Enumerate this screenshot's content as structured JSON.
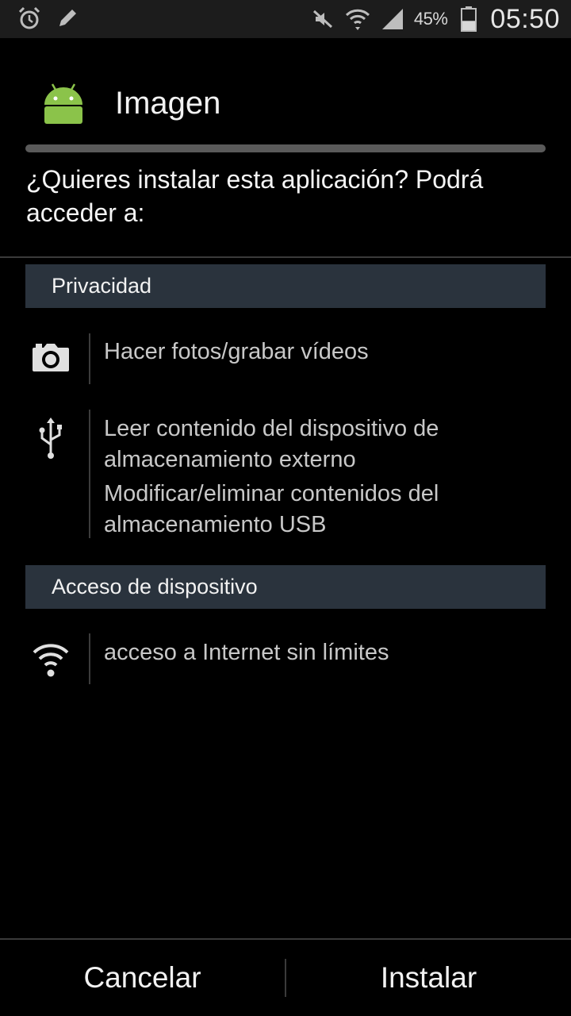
{
  "status_bar": {
    "left_icons": [
      "alarm-clock-icon",
      "pencil-icon"
    ],
    "right_icons": [
      "mute-icon",
      "wifi-icon",
      "signal-icon",
      "battery-icon"
    ],
    "battery_percent": "45%",
    "battery_level": 0.45,
    "time": "05:50"
  },
  "app": {
    "name": "Imagen",
    "icon": "android-robot-icon",
    "icon_color": "#8bc34a"
  },
  "prompt": "¿Quieres instalar esta aplicación? Podrá acceder a:",
  "sections": [
    {
      "title": "Privacidad",
      "permissions": [
        {
          "icon": "camera-icon",
          "lines": [
            "Hacer fotos/grabar vídeos"
          ]
        },
        {
          "icon": "usb-icon",
          "lines": [
            "Leer contenido del dispositivo de almacenamiento externo",
            "Modificar/eliminar contenidos del almacenamiento USB"
          ]
        }
      ]
    },
    {
      "title": "Acceso de dispositivo",
      "permissions": [
        {
          "icon": "wifi-icon",
          "lines": [
            "acceso a Internet sin límites"
          ]
        }
      ]
    }
  ],
  "buttons": {
    "cancel": "Cancelar",
    "install": "Instalar"
  },
  "colors": {
    "background": "#000000",
    "section_header": "#2a333d",
    "permission_text": "#c8c8c8"
  }
}
